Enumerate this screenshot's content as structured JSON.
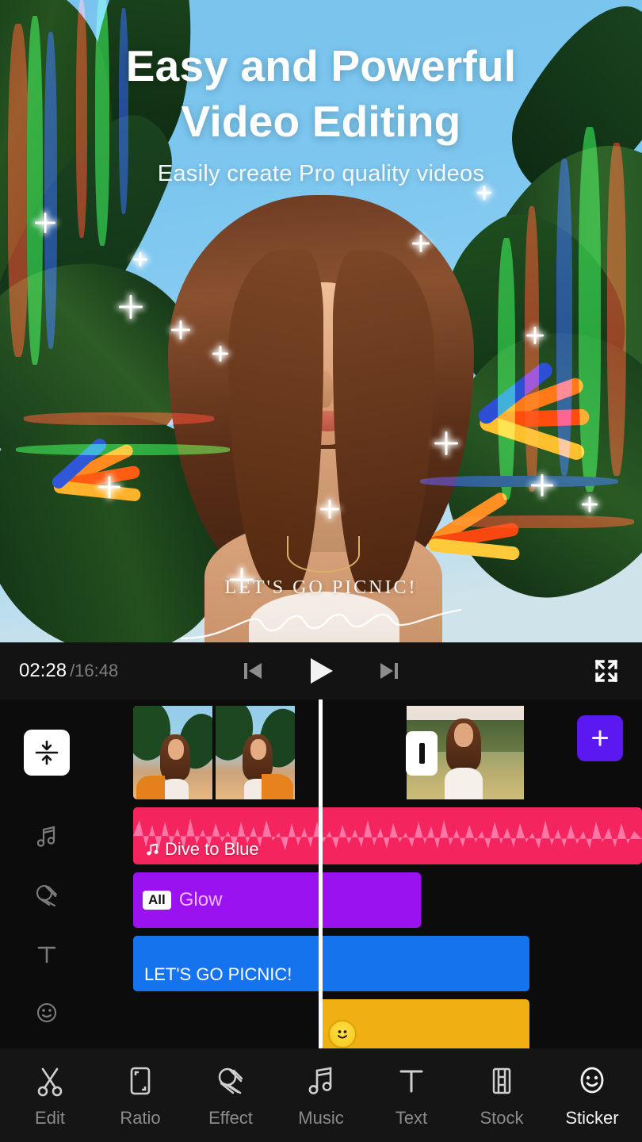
{
  "preview": {
    "headline_line1": "Easy and Powerful",
    "headline_line2": "Video Editing",
    "subheadline": "Easily create Pro quality videos",
    "caption_overlay": "LET'S GO PICNIC!"
  },
  "player": {
    "current_time": "02:28",
    "total_time": "/16:48",
    "prev_icon": "skip-previous-icon",
    "play_icon": "play-icon",
    "next_icon": "skip-next-icon",
    "expand_icon": "fullscreen-expand-icon"
  },
  "timeline": {
    "rail": {
      "collapse_icon": "collapse-tracks-icon",
      "items": [
        {
          "icon": "music-note-icon",
          "name": "rail-music"
        },
        {
          "icon": "effect-swirl-icon",
          "name": "rail-effect"
        },
        {
          "icon": "text-t-icon",
          "name": "rail-text"
        },
        {
          "icon": "sticker-smiley-icon",
          "name": "rail-sticker"
        }
      ]
    },
    "video_track": {
      "clip_count": 2
    },
    "audio_track": {
      "label": "Dive to Blue",
      "icon": "music-note-icon",
      "color": "#f4245e"
    },
    "effect_track": {
      "badge": "All",
      "label": "Glow",
      "color": "#9b12f0"
    },
    "text_track": {
      "label": "LET'S GO PICNIC!",
      "color": "#1673ee"
    },
    "sticker_track": {
      "icon": "smiley-sticker-icon",
      "color": "#f0b014"
    },
    "transition_button": "transition-icon",
    "add_button": "+",
    "playhead": "playhead-marker"
  },
  "bottom_nav": {
    "items": [
      {
        "label": "Edit",
        "icon": "scissors-icon",
        "active": false
      },
      {
        "label": "Ratio",
        "icon": "crop-ratio-icon",
        "active": false
      },
      {
        "label": "Effect",
        "icon": "effect-swirl-icon",
        "active": false
      },
      {
        "label": "Music",
        "icon": "music-note-icon",
        "active": false
      },
      {
        "label": "Text",
        "icon": "text-t-icon",
        "active": false
      },
      {
        "label": "Stock",
        "icon": "film-strip-icon",
        "active": false
      },
      {
        "label": "Sticker",
        "icon": "smiley-icon",
        "active": true
      }
    ]
  },
  "colors": {
    "audio": "#f4245e",
    "effect": "#9b12f0",
    "text": "#1673ee",
    "sticker": "#f0b014",
    "add_button": "#5b18f0"
  }
}
